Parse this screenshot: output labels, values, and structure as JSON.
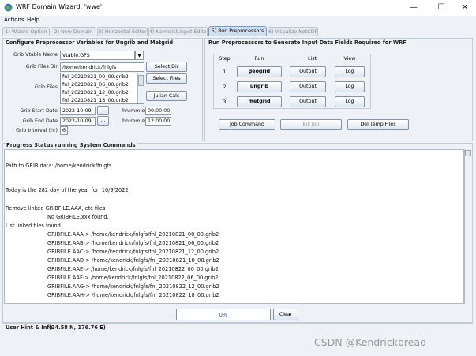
{
  "window": {
    "title": "WRF Domain Wizard: 'wwe'",
    "minimize": "—",
    "maximize": "☐",
    "close": "✕"
  },
  "menu": [
    "Actions",
    "Help"
  ],
  "tabs": [
    {
      "label": "1) Wizard Option",
      "active": false
    },
    {
      "label": "2) New Domain",
      "active": false
    },
    {
      "label": "3) Horizontal Editor",
      "active": false
    },
    {
      "label": "4) Namelist.input Editor",
      "active": false
    },
    {
      "label": "5) Run Preprocessors",
      "active": true
    },
    {
      "label": "6) Visualize NetCDF",
      "active": false
    }
  ],
  "config": {
    "title": "Configure Preprocessor Variables for Ungrib and Metgrid",
    "vtable_label": "Grib Vtable Name",
    "vtable_value": "Vtable.GFS",
    "dir_label": "Grib Files Dir",
    "dir_value": "/home/kendrick/fnlgfs",
    "select_dir": "Select Dir",
    "files_label": "Grib Files",
    "files": [
      "fnl_20210821_00_00.grib2",
      "fnl_20210821_06_00.grib2",
      "fnl_20210821_12_00.grib2",
      "fnl_20210821_18_00.grib2"
    ],
    "select_files": "Select Files",
    "julian_calc": "Julian Calc",
    "start_label": "Grib Start Date",
    "start_date": "2022-10-09",
    "end_label": "Grib End Date",
    "end_date": "2022-10-09",
    "picker": "...",
    "time_label": "hh:mm:ss",
    "start_time": "00:00:00",
    "end_time": "12:00:00",
    "interval_label": "Grib Interval (hr)",
    "interval": "6"
  },
  "run": {
    "title": "Run Preprocessors to Generate Input Data Fields Required for WRF",
    "headers": [
      "Step",
      "Run",
      "List",
      "View"
    ],
    "rows": [
      {
        "step": "1",
        "run": "geogrid",
        "list": "Output",
        "view": "Log"
      },
      {
        "step": "2",
        "run": "ungrib",
        "list": "Output",
        "view": "Log"
      },
      {
        "step": "3",
        "run": "metgrid",
        "list": "Output",
        "view": "Log"
      }
    ],
    "job_command": "Job Command",
    "kill_job": "Kill Job",
    "del_temp": "Del Temp Files"
  },
  "status": {
    "title": "Progress Status running System Commands",
    "lines": [
      "Path to GRIB data: /home/kendrick/fnlgfs",
      "Today is the 282 day of the year for: 10/9/2022",
      "Remove linked GRIBFILE.AAA, etc files",
      "No GRIBFILE.xxx found.",
      "List linked files found",
      "GRIBFILE.AAA-> /home/kendrick/fnlgfs/fnl_20210821_00_00.grib2",
      "GRIBFILE.AAB-> /home/kendrick/fnlgfs/fnl_20210821_06_00.grib2",
      "GRIBFILE.AAC-> /home/kendrick/fnlgfs/fnl_20210821_12_00.grib2",
      "GRIBFILE.AAD-> /home/kendrick/fnlgfs/fnl_20210821_18_00.grib2",
      "GRIBFILE.AAE-> /home/kendrick/fnlgfs/fnl_20210822_00_00.grib2",
      "GRIBFILE.AAF-> /home/kendrick/fnlgfs/fnl_20210822_06_00.grib2",
      "GRIBFILE.AAG-> /home/kendrick/fnlgfs/fnl_20210822_12_00.grib2",
      "GRIBFILE.AAH-> /home/kendrick/fnlgfs/fnl_20210822_18_00.grib2"
    ],
    "progress": "0%",
    "progress_value": 0,
    "clear": "Clear"
  },
  "hint": {
    "label": "User Hint & Info",
    "coords": "(24.58 N, 176.76 E)"
  },
  "watermark": "CSDN @Kendrickbread",
  "colors": {
    "accent": "#1a4a8a",
    "tab_active": "#cfe0f2",
    "window_bg": "#eef1f5"
  }
}
